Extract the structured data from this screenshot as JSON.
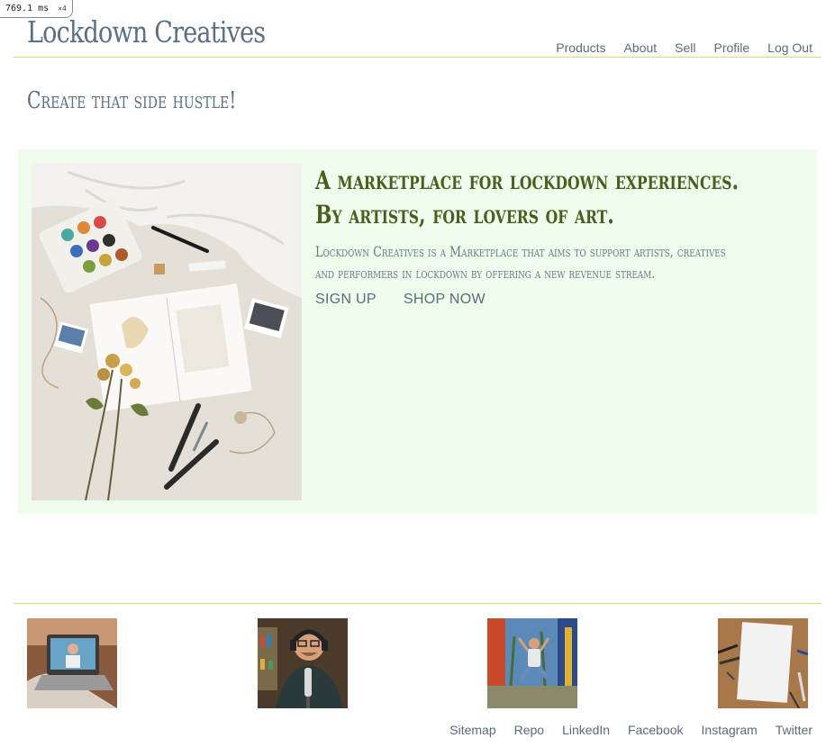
{
  "debug": {
    "timing": "769.1",
    "unit": "ms",
    "multiplier": "×4"
  },
  "brand": {
    "name": "Lockdown Creatives"
  },
  "nav": {
    "items": [
      "Products",
      "About",
      "Sell",
      "Profile",
      "Log Out"
    ]
  },
  "hero": {
    "tagline": "Create that side hustle!",
    "headline_line1": "A marketplace for lockdown experiences.",
    "headline_line2": "By artists, for lovers of art.",
    "description": "Lockdown Creatives is a Marketplace that aims to support artists, creatives and performers in lockdown by offering a new revenue stream.",
    "signup": "SIGN UP",
    "shop": "SHOP NOW"
  },
  "footer": {
    "links": [
      "Sitemap",
      "Repo",
      "LinkedIn",
      "Facebook",
      "Instagram",
      "Twitter"
    ]
  },
  "colors": {
    "accent_rule": "#cfe07a",
    "hero_bg": "#effdec",
    "headline": "#4a5e1f",
    "text": "#5a6b7b"
  }
}
